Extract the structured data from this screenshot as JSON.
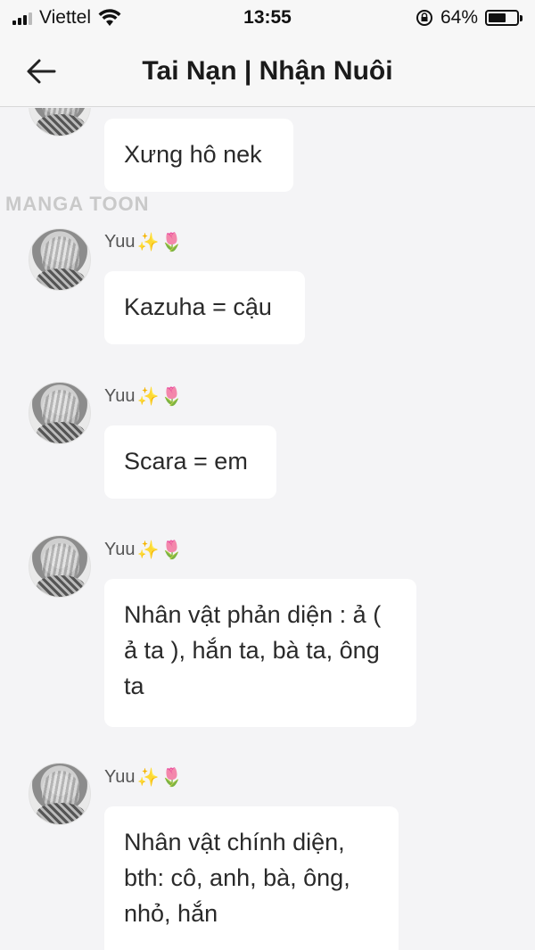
{
  "status_bar": {
    "carrier": "Viettel",
    "time": "13:55",
    "battery_percent": "64%",
    "battery_level": 0.64
  },
  "header": {
    "title": "Tai Nạn | Nhận Nuôi"
  },
  "watermark": "MANGA TOON",
  "messages": [
    {
      "sender": "",
      "text": "Xưng hô nek"
    },
    {
      "sender": "Yuu",
      "text": "Kazuha = cậu"
    },
    {
      "sender": "Yuu",
      "text": "Scara = em"
    },
    {
      "sender": "Yuu",
      "text": "Nhân vật phản diện : ả ( ả ta ), hắn ta, bà ta, ông ta"
    },
    {
      "sender": "Yuu",
      "text": "Nhân vật chính diện, bth: cô, anh, bà, ông, nhỏ, hắn"
    }
  ],
  "icons": {
    "sender_decor_1": "sparkles-emoji",
    "sender_decor_2": "tulip-emoji"
  },
  "colors": {
    "background": "#f4f4f6",
    "bubble": "#ffffff"
  }
}
